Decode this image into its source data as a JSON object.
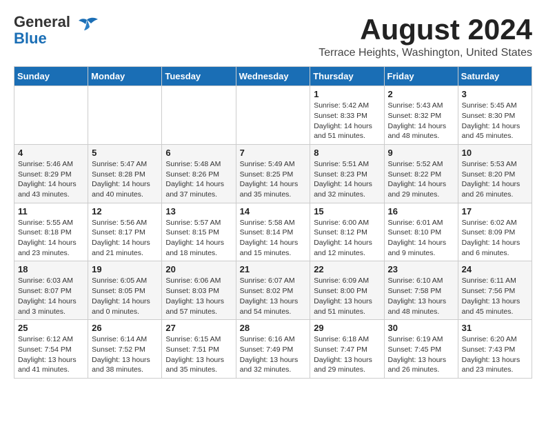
{
  "header": {
    "logo_general": "General",
    "logo_blue": "Blue",
    "month_title": "August 2024",
    "location": "Terrace Heights, Washington, United States"
  },
  "days_of_week": [
    "Sunday",
    "Monday",
    "Tuesday",
    "Wednesday",
    "Thursday",
    "Friday",
    "Saturday"
  ],
  "weeks": [
    [
      {
        "day": "",
        "info": ""
      },
      {
        "day": "",
        "info": ""
      },
      {
        "day": "",
        "info": ""
      },
      {
        "day": "",
        "info": ""
      },
      {
        "day": "1",
        "info": "Sunrise: 5:42 AM\nSunset: 8:33 PM\nDaylight: 14 hours\nand 51 minutes."
      },
      {
        "day": "2",
        "info": "Sunrise: 5:43 AM\nSunset: 8:32 PM\nDaylight: 14 hours\nand 48 minutes."
      },
      {
        "day": "3",
        "info": "Sunrise: 5:45 AM\nSunset: 8:30 PM\nDaylight: 14 hours\nand 45 minutes."
      }
    ],
    [
      {
        "day": "4",
        "info": "Sunrise: 5:46 AM\nSunset: 8:29 PM\nDaylight: 14 hours\nand 43 minutes."
      },
      {
        "day": "5",
        "info": "Sunrise: 5:47 AM\nSunset: 8:28 PM\nDaylight: 14 hours\nand 40 minutes."
      },
      {
        "day": "6",
        "info": "Sunrise: 5:48 AM\nSunset: 8:26 PM\nDaylight: 14 hours\nand 37 minutes."
      },
      {
        "day": "7",
        "info": "Sunrise: 5:49 AM\nSunset: 8:25 PM\nDaylight: 14 hours\nand 35 minutes."
      },
      {
        "day": "8",
        "info": "Sunrise: 5:51 AM\nSunset: 8:23 PM\nDaylight: 14 hours\nand 32 minutes."
      },
      {
        "day": "9",
        "info": "Sunrise: 5:52 AM\nSunset: 8:22 PM\nDaylight: 14 hours\nand 29 minutes."
      },
      {
        "day": "10",
        "info": "Sunrise: 5:53 AM\nSunset: 8:20 PM\nDaylight: 14 hours\nand 26 minutes."
      }
    ],
    [
      {
        "day": "11",
        "info": "Sunrise: 5:55 AM\nSunset: 8:18 PM\nDaylight: 14 hours\nand 23 minutes."
      },
      {
        "day": "12",
        "info": "Sunrise: 5:56 AM\nSunset: 8:17 PM\nDaylight: 14 hours\nand 21 minutes."
      },
      {
        "day": "13",
        "info": "Sunrise: 5:57 AM\nSunset: 8:15 PM\nDaylight: 14 hours\nand 18 minutes."
      },
      {
        "day": "14",
        "info": "Sunrise: 5:58 AM\nSunset: 8:14 PM\nDaylight: 14 hours\nand 15 minutes."
      },
      {
        "day": "15",
        "info": "Sunrise: 6:00 AM\nSunset: 8:12 PM\nDaylight: 14 hours\nand 12 minutes."
      },
      {
        "day": "16",
        "info": "Sunrise: 6:01 AM\nSunset: 8:10 PM\nDaylight: 14 hours\nand 9 minutes."
      },
      {
        "day": "17",
        "info": "Sunrise: 6:02 AM\nSunset: 8:09 PM\nDaylight: 14 hours\nand 6 minutes."
      }
    ],
    [
      {
        "day": "18",
        "info": "Sunrise: 6:03 AM\nSunset: 8:07 PM\nDaylight: 14 hours\nand 3 minutes."
      },
      {
        "day": "19",
        "info": "Sunrise: 6:05 AM\nSunset: 8:05 PM\nDaylight: 14 hours\nand 0 minutes."
      },
      {
        "day": "20",
        "info": "Sunrise: 6:06 AM\nSunset: 8:03 PM\nDaylight: 13 hours\nand 57 minutes."
      },
      {
        "day": "21",
        "info": "Sunrise: 6:07 AM\nSunset: 8:02 PM\nDaylight: 13 hours\nand 54 minutes."
      },
      {
        "day": "22",
        "info": "Sunrise: 6:09 AM\nSunset: 8:00 PM\nDaylight: 13 hours\nand 51 minutes."
      },
      {
        "day": "23",
        "info": "Sunrise: 6:10 AM\nSunset: 7:58 PM\nDaylight: 13 hours\nand 48 minutes."
      },
      {
        "day": "24",
        "info": "Sunrise: 6:11 AM\nSunset: 7:56 PM\nDaylight: 13 hours\nand 45 minutes."
      }
    ],
    [
      {
        "day": "25",
        "info": "Sunrise: 6:12 AM\nSunset: 7:54 PM\nDaylight: 13 hours\nand 41 minutes."
      },
      {
        "day": "26",
        "info": "Sunrise: 6:14 AM\nSunset: 7:52 PM\nDaylight: 13 hours\nand 38 minutes."
      },
      {
        "day": "27",
        "info": "Sunrise: 6:15 AM\nSunset: 7:51 PM\nDaylight: 13 hours\nand 35 minutes."
      },
      {
        "day": "28",
        "info": "Sunrise: 6:16 AM\nSunset: 7:49 PM\nDaylight: 13 hours\nand 32 minutes."
      },
      {
        "day": "29",
        "info": "Sunrise: 6:18 AM\nSunset: 7:47 PM\nDaylight: 13 hours\nand 29 minutes."
      },
      {
        "day": "30",
        "info": "Sunrise: 6:19 AM\nSunset: 7:45 PM\nDaylight: 13 hours\nand 26 minutes."
      },
      {
        "day": "31",
        "info": "Sunrise: 6:20 AM\nSunset: 7:43 PM\nDaylight: 13 hours\nand 23 minutes."
      }
    ]
  ]
}
